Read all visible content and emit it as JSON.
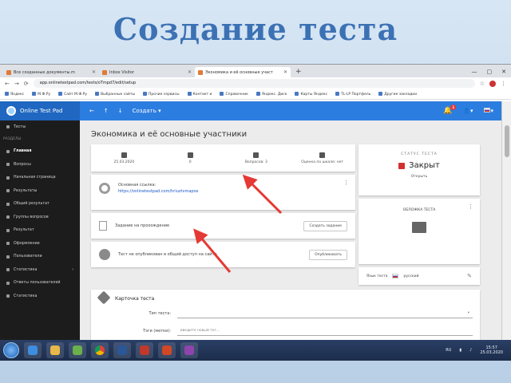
{
  "slide": {
    "title": "Создание теста"
  },
  "browser": {
    "tabs": [
      {
        "label": "Все созданные документы.m"
      },
      {
        "label": "Inbox Visitor"
      },
      {
        "label": "Экономика и её основные участ"
      }
    ],
    "url": "app.onlinetestpad.com/tests/oTmpd7/edit/setup",
    "bookmarks": [
      "Яндекс",
      "М.Ф.Ру",
      "Сайт М.Ф.Ру",
      "Выбранные сайты",
      "Прочие сервисы",
      "Контакт и",
      "Справочник",
      "Яндекс. Диск",
      "Карты Яндекс",
      "TL-LP Портфель",
      "Другие закладки"
    ]
  },
  "app": {
    "brand": "Online Test Pad",
    "nav_create": "Создать",
    "notif_count": "1",
    "sidebar": {
      "items": [
        {
          "label": "Тесты",
          "active": false
        },
        {
          "section": "РАЗДЕЛЫ"
        },
        {
          "label": "Главная",
          "active": true
        },
        {
          "label": "Вопросы",
          "active": false
        },
        {
          "label": "Начальная страница",
          "active": false
        },
        {
          "label": "Результаты",
          "active": false
        },
        {
          "label": "Общий результат",
          "active": false
        },
        {
          "label": "Группы вопросов",
          "active": false
        },
        {
          "label": "Результат",
          "active": false
        },
        {
          "label": "Оформление",
          "active": false
        },
        {
          "label": "Пользователи",
          "active": false
        },
        {
          "label": "Статистика",
          "active": false
        },
        {
          "label": "Ответы пользователей",
          "active": false
        },
        {
          "label": "Статистика",
          "active": false
        }
      ]
    },
    "page_title": "Экономика и её основные участники",
    "stats": [
      {
        "icon": "calendar-icon",
        "label": "25.03.2020"
      },
      {
        "icon": "users-icon",
        "label": "0"
      },
      {
        "icon": "chat-icon",
        "label": "Вопросов: 3"
      },
      {
        "icon": "list-icon",
        "label": "Оценка по шкале: нет"
      }
    ],
    "link_card": {
      "label": "Основная ссылка:",
      "url": "https://onlinetestpad.com/hriuztvmapox"
    },
    "task_card": {
      "text": "Задание на прохождение",
      "button": "Создать задание"
    },
    "share_card": {
      "text": "Тест не опубликован в общий доступ на сайте",
      "button": "Опубликовать"
    },
    "status": {
      "label": "СТАТУС ТЕСТА",
      "value": "Закрыт",
      "action": "Открыть"
    },
    "cover": {
      "label": "ОБЛОЖКА ТЕСТА"
    },
    "language": {
      "label": "Язык теста",
      "value": "русский"
    },
    "test_card": {
      "title": "Карточка теста",
      "type_label": "Тип теста:",
      "type_value": "",
      "tags_label": "Тэги (метки):",
      "tags_placeholder": "введите новый тег..."
    }
  },
  "taskbar": {
    "lang": "RU",
    "time": "15:57",
    "date": "25.03.2020"
  },
  "colors": {
    "accent": "#2c7de0",
    "sidebar": "#1c1c1c",
    "arrow": "#e53935"
  }
}
